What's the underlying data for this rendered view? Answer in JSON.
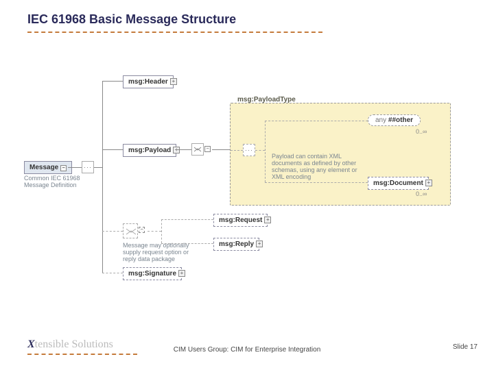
{
  "title": "IEC 61968 Basic Message Structure",
  "root": {
    "label": "Message",
    "caption": "Common IEC 61968 Message Definition",
    "children": {
      "header": "msg:Header",
      "payload": "msg:Payload",
      "requestOption": "",
      "signature": "msg:Signature"
    }
  },
  "optional_caption": "Message may optionally supply request option or reply data package",
  "payload": {
    "type_title": "msg:PayloadType",
    "any_label": "any ##other",
    "any_card": "0..∞",
    "note": "Payload can contain XML documents as defined by other schemas, using any element or XML encoding",
    "document": "msg:Document",
    "document_card": "0..∞"
  },
  "sub_group": {
    "request": "msg:Request",
    "reply": "msg:Reply"
  },
  "footer": {
    "logo": "Xtensible Solutions",
    "center": "CIM Users Group: CIM for Enterprise Integration",
    "slide_label": "Slide",
    "slide_num": "17"
  }
}
